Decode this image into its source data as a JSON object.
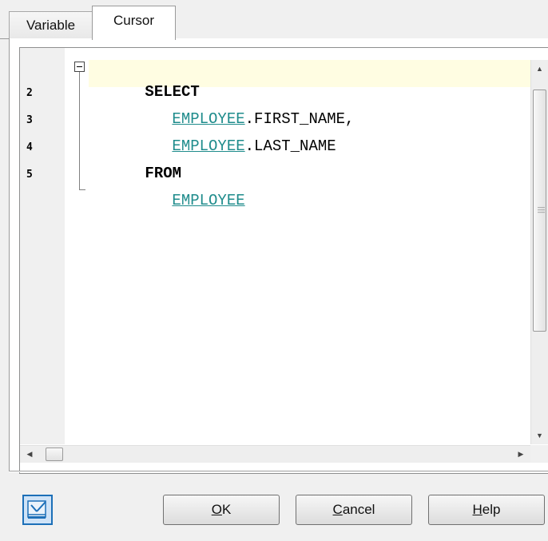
{
  "tabs": [
    {
      "label": "Variable",
      "active": false
    },
    {
      "label": "Cursor",
      "active": true
    }
  ],
  "editor": {
    "line_numbers": [
      "2",
      "3",
      "4",
      "5"
    ],
    "lines": [
      {
        "tokens": [
          {
            "text": "SELECT",
            "type": "keyword"
          }
        ]
      },
      {
        "tokens": [
          {
            "text": "EMPLOYEE",
            "type": "table"
          },
          {
            "text": ".FIRST_NAME,",
            "type": "plain"
          }
        ]
      },
      {
        "tokens": [
          {
            "text": "EMPLOYEE",
            "type": "table"
          },
          {
            "text": ".LAST_NAME",
            "type": "plain"
          }
        ]
      },
      {
        "tokens": [
          {
            "text": "FROM",
            "type": "keyword"
          }
        ]
      },
      {
        "tokens": [
          {
            "text": "EMPLOYEE",
            "type": "table"
          }
        ]
      }
    ],
    "colors": {
      "current_line": "#fffde2",
      "table_link": "#1f8c8c",
      "gutter": "#f0f0f0"
    }
  },
  "buttons": {
    "ok": {
      "accel": "O",
      "rest": "K"
    },
    "cancel": {
      "accel": "C",
      "rest": "ancel"
    },
    "help": {
      "accel": "H",
      "rest": "elp"
    }
  },
  "icons": {
    "query_builder": "query-builder-icon",
    "scroll_up": "scroll-up-arrow-icon",
    "scroll_down": "scroll-down-arrow-icon",
    "scroll_left": "scroll-left-arrow-icon",
    "scroll_right": "scroll-right-arrow-icon",
    "fold": "collapse-fold-icon"
  }
}
